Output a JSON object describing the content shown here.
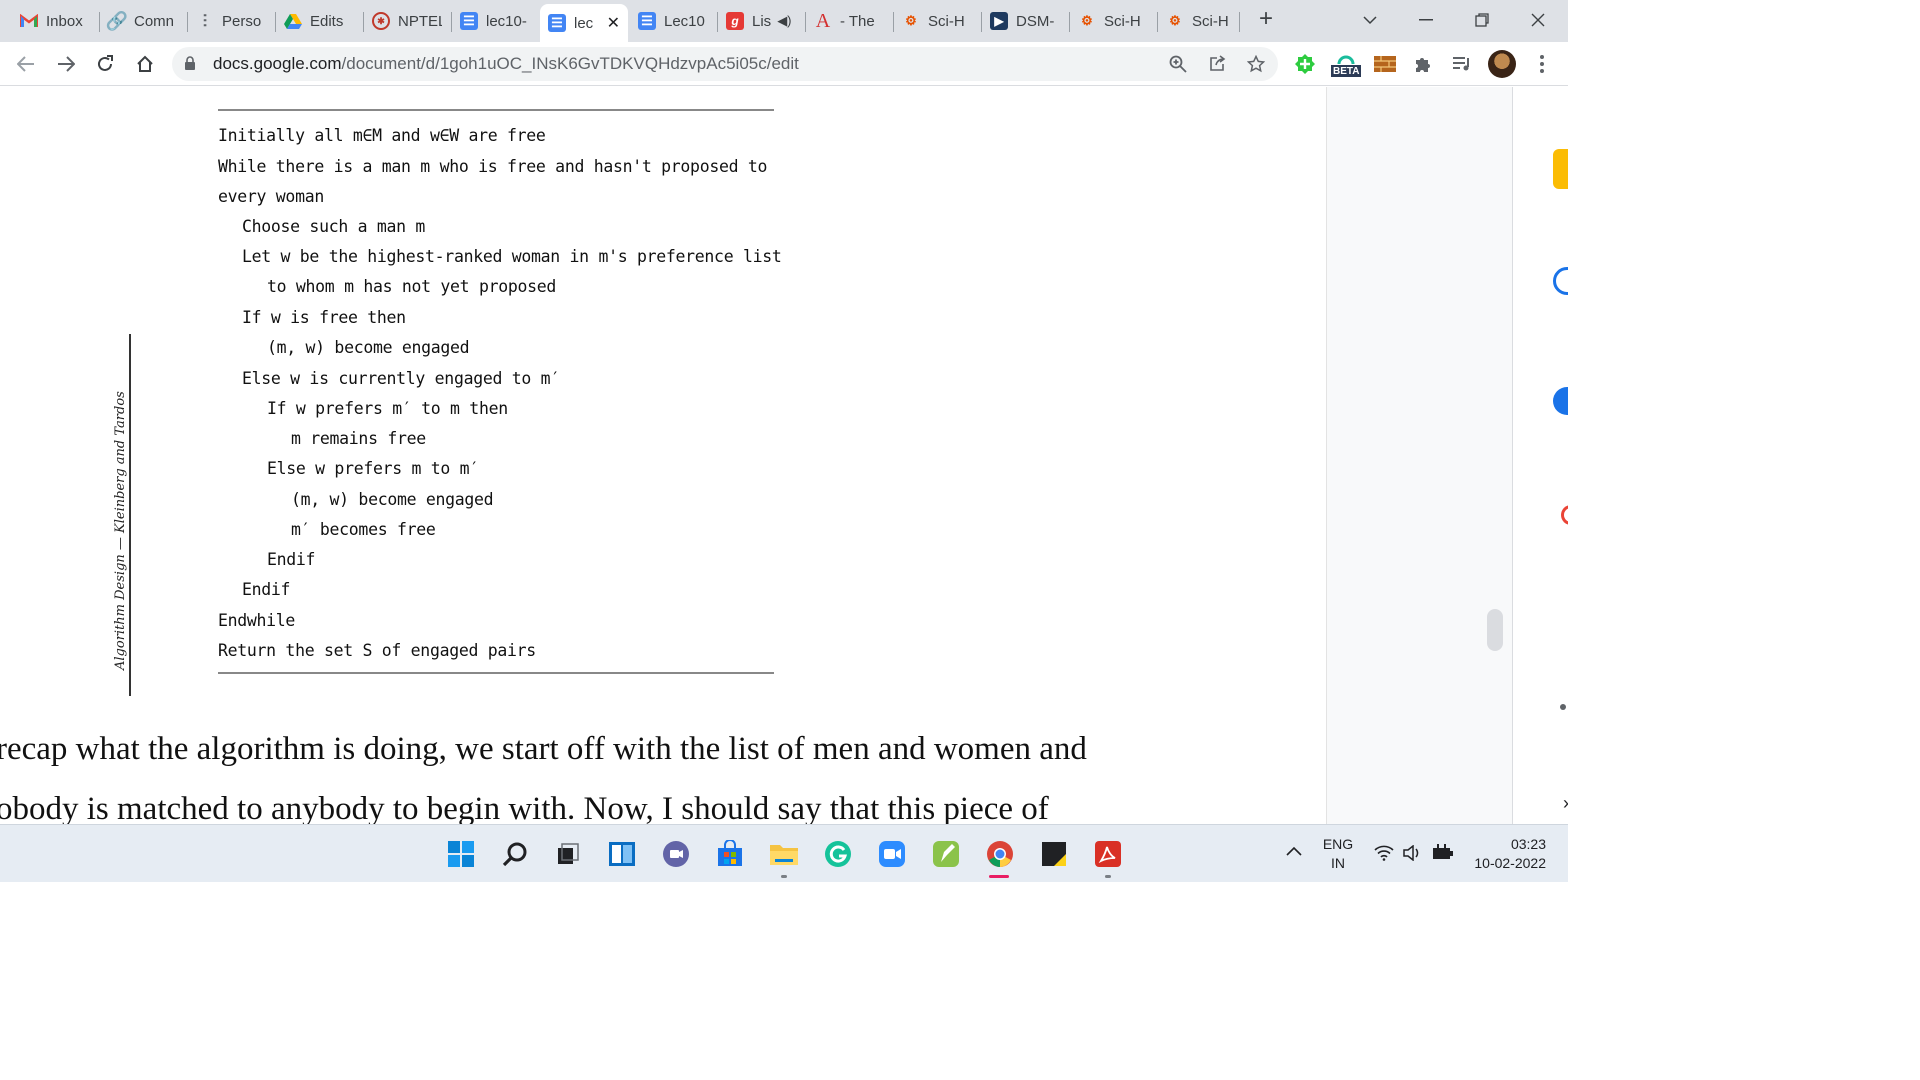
{
  "browser": {
    "tabs": [
      {
        "label": "Inbox",
        "icon": "gmail-icon"
      },
      {
        "label": "Comn",
        "icon": "link-icon"
      },
      {
        "label": "Perso",
        "icon": "webpage-icon"
      },
      {
        "label": "Edits",
        "icon": "drive-icon"
      },
      {
        "label": "NPTEL",
        "icon": "nptel-icon"
      },
      {
        "label": "lec10-",
        "icon": "docs-icon"
      },
      {
        "label": "lec",
        "icon": "docs-icon",
        "active": true
      },
      {
        "label": "Lec10",
        "icon": "docs-icon"
      },
      {
        "label": "Lis",
        "icon": "g-icon",
        "audio": true
      },
      {
        "label": "- The",
        "icon": "a-icon"
      },
      {
        "label": "Sci-H",
        "icon": "scihub-icon"
      },
      {
        "label": "DSM-",
        "icon": "arrow-icon"
      },
      {
        "label": "Sci-H",
        "icon": "scihub-icon"
      },
      {
        "label": "Sci-H",
        "icon": "scihub-icon"
      }
    ],
    "url_domain": "docs.google.com",
    "url_path": "/document/d/1goh1uOC_INsK6GvTDKVQHdzvpAc5i05c/edit",
    "extension_badge": "BETA"
  },
  "document": {
    "algorithm_lines": [
      {
        "text": "Initially all m∈M and w∈W are free",
        "indent": 0
      },
      {
        "text": "While there is a man m who is free and hasn't proposed to",
        "indent": 0
      },
      {
        "text": "every woman",
        "indent": 0
      },
      {
        "text": "Choose such a man m",
        "indent": 1
      },
      {
        "text": "Let w be the highest-ranked woman in m's preference list",
        "indent": 1
      },
      {
        "text": "to whom m has not yet proposed",
        "indent": 2
      },
      {
        "text": "If w is free then",
        "indent": 1
      },
      {
        "text": "(m, w) become engaged",
        "indent": 2
      },
      {
        "text": "Else w is currently engaged to m′",
        "indent": 1
      },
      {
        "text": "If w prefers m′ to m then",
        "indent": 2
      },
      {
        "text": "m remains free",
        "indent": 3
      },
      {
        "text": "Else w prefers m to m′",
        "indent": 2
      },
      {
        "text": "(m, w) become engaged",
        "indent": 3
      },
      {
        "text": "m′ becomes free",
        "indent": 3
      },
      {
        "text": "Endif",
        "indent": 2
      },
      {
        "text": "Endif",
        "indent": 1
      },
      {
        "text": "Endwhile",
        "indent": 0
      },
      {
        "text": "Return the set S of engaged pairs",
        "indent": 0
      }
    ],
    "side_caption": "Algorithm Design — Kleinberg and Tardos",
    "body_lines": [
      " recap what the algorithm is doing, we start off with the list of men and women and",
      "obody is matched to anybody to begin with. Now, I should say that this piece of"
    ]
  },
  "taskbar": {
    "apps": [
      "windows-start-icon",
      "search-icon",
      "task-view-icon",
      "widgets-icon",
      "teams-chat-icon",
      "store-icon",
      "file-explorer-icon",
      "grammarly-icon",
      "zoom-icon",
      "notes-app-icon",
      "chrome-icon",
      "sticky-notes-icon",
      "acrobat-icon"
    ],
    "language": "ENG",
    "region": "IN",
    "time": "03:23",
    "date": "10-02-2022"
  }
}
